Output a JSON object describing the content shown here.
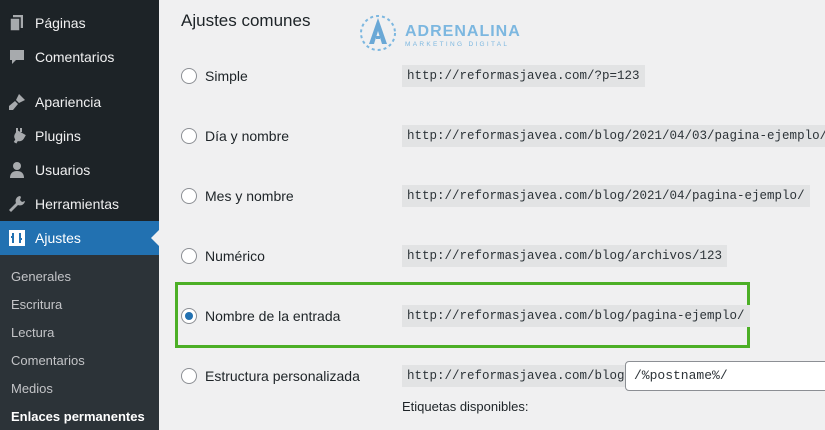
{
  "sidebar": {
    "items": [
      {
        "label": "Páginas",
        "icon": "pages-icon"
      },
      {
        "label": "Comentarios",
        "icon": "comments-icon"
      },
      {
        "label": "Apariencia",
        "icon": "appearance-icon"
      },
      {
        "label": "Plugins",
        "icon": "plugins-icon"
      },
      {
        "label": "Usuarios",
        "icon": "users-icon"
      },
      {
        "label": "Herramientas",
        "icon": "tools-icon"
      },
      {
        "label": "Ajustes",
        "icon": "settings-icon",
        "active": true
      }
    ],
    "submenu": [
      {
        "label": "Generales"
      },
      {
        "label": "Escritura"
      },
      {
        "label": "Lectura"
      },
      {
        "label": "Comentarios"
      },
      {
        "label": "Medios"
      },
      {
        "label": "Enlaces permanentes",
        "current": true
      }
    ]
  },
  "main": {
    "section_title": "Ajustes comunes",
    "logo": {
      "name": "ADRENALINA",
      "tagline": "MARKETING DIGITAL"
    },
    "options": [
      {
        "label": "Simple",
        "example": "http://reformasjavea.com/?p=123",
        "checked": false
      },
      {
        "label": "Día y nombre",
        "example": "http://reformasjavea.com/blog/2021/04/03/pagina-ejemplo/",
        "checked": false
      },
      {
        "label": "Mes y nombre",
        "example": "http://reformasjavea.com/blog/2021/04/pagina-ejemplo/",
        "checked": false
      },
      {
        "label": "Numérico",
        "example": "http://reformasjavea.com/blog/archivos/123",
        "checked": false
      },
      {
        "label": "Nombre de la entrada",
        "example": "http://reformasjavea.com/blog/pagina-ejemplo/",
        "checked": true
      },
      {
        "label": "Estructura personalizada",
        "example": "http://reformasjavea.com/blog",
        "checked": false
      }
    ],
    "custom_structure_value": "/%postname%/",
    "available_tags_label": "Etiquetas disponibles:"
  },
  "colors": {
    "sidebar_bg": "#1d2327",
    "active_bg": "#2271b1",
    "highlight_border": "#4caf26"
  }
}
